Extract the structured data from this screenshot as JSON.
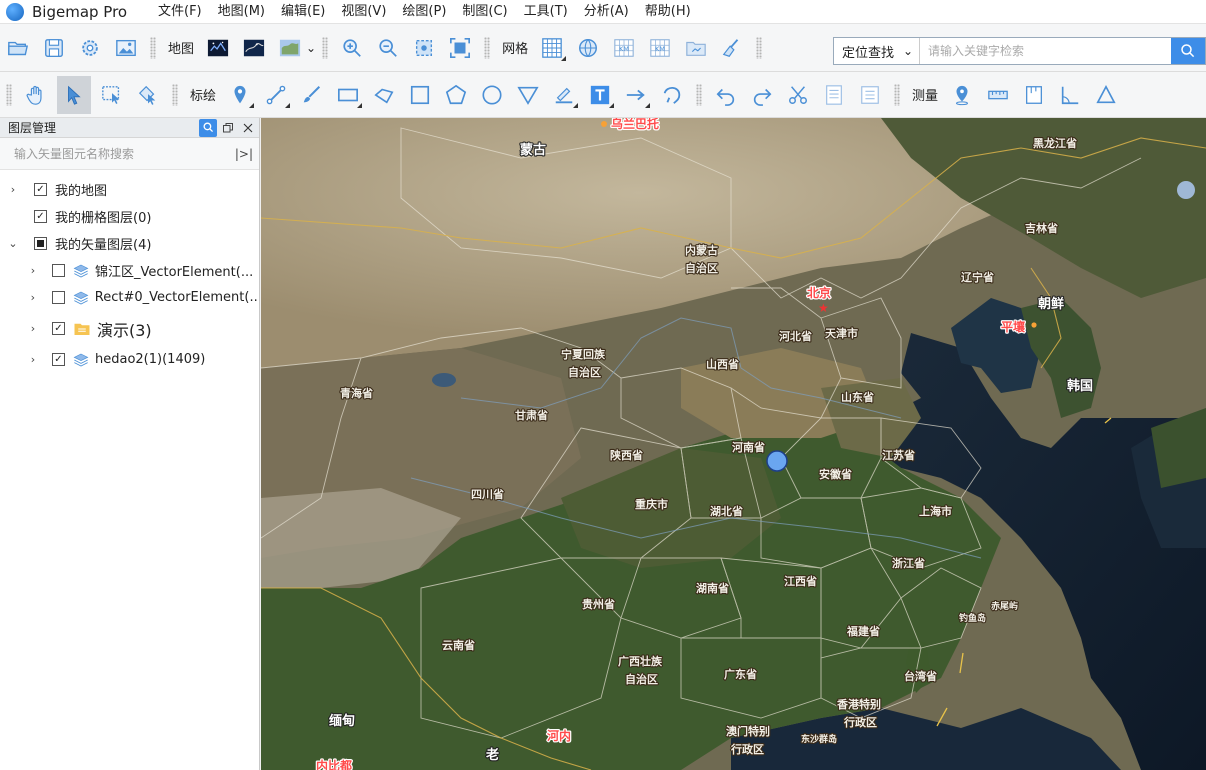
{
  "app": {
    "name": "Bigemap Pro"
  },
  "menu": [
    "文件(F)",
    "地图(M)",
    "编辑(E)",
    "视图(V)",
    "绘图(P)",
    "制图(C)",
    "工具(T)",
    "分析(A)",
    "帮助(H)"
  ],
  "toolbar1": {
    "map_label": "地图",
    "grid_label": "网格",
    "search": {
      "mode": "定位查找",
      "placeholder": "请输入关键字检索"
    }
  },
  "toolbar2": {
    "draw_label": "标绘",
    "measure_label": "测量"
  },
  "layer_panel": {
    "title": "图层管理",
    "search_placeholder": "输入矢量图元名称搜索",
    "items": [
      {
        "label": "我的地图",
        "level": 0,
        "expand": "›",
        "check": "checked"
      },
      {
        "label": "我的栅格图层(0)",
        "level": 0,
        "expand": "",
        "check": "checked"
      },
      {
        "label": "我的矢量图层(4)",
        "level": 0,
        "expand": "⌄",
        "check": "partial"
      },
      {
        "label": "锦江区_VectorElement(...",
        "level": 1,
        "expand": "›",
        "check": "unchecked",
        "icon": "layers"
      },
      {
        "label": "Rect#0_VectorElement(...",
        "level": 1,
        "expand": "›",
        "check": "unchecked",
        "icon": "layers"
      },
      {
        "label": "演示(3)",
        "level": 1,
        "expand": "›",
        "check": "checked",
        "icon": "folder"
      },
      {
        "label": "hedao2(1)(1409)",
        "level": 1,
        "expand": "›",
        "check": "checked",
        "icon": "layers"
      }
    ]
  },
  "map_labels": {
    "wulanbatuo": "乌兰巴托",
    "mongolia": "蒙古",
    "heilongjiang": "黑龙江省",
    "jilin": "吉林省",
    "neimenggu_1": "内蒙古",
    "neimenggu_2": "自治区",
    "liaoning": "辽宁省",
    "beijing": "北京",
    "hebei": "河北省",
    "tianjin": "天津市",
    "dprk": "朝鲜",
    "pyongyang": "平壤",
    "ningxia_1": "宁夏回族",
    "ningxia_2": "自治区",
    "shanxi": "山西省",
    "korea": "韩国",
    "qinghai": "青海省",
    "shandong": "山东省",
    "gansu": "甘肃省",
    "henan": "河南省",
    "jiangsu": "江苏省",
    "shaanxi": "陕西省",
    "anhui": "安徽省",
    "sichuan": "四川省",
    "chongqing": "重庆市",
    "hubei": "湖北省",
    "shanghai": "上海市",
    "zhejiang": "浙江省",
    "hunan": "湖南省",
    "jiangxi": "江西省",
    "guizhou": "贵州省",
    "chiweiyu": "赤尾屿",
    "diaoyudao": "钓鱼岛",
    "fujian": "福建省",
    "yunnan": "云南省",
    "guangxi_1": "广西壮族",
    "guangxi_2": "自治区",
    "guangdong": "广东省",
    "taiwan": "台湾省",
    "hongkong_1": "香港特别",
    "hongkong_2": "行政区",
    "myanmar": "缅甸",
    "macau_1": "澳门特别",
    "macau_2": "行政区",
    "dongsha": "东沙群岛",
    "hanoi": "河内",
    "laos": "老",
    "naypyidaw": "内比都"
  }
}
